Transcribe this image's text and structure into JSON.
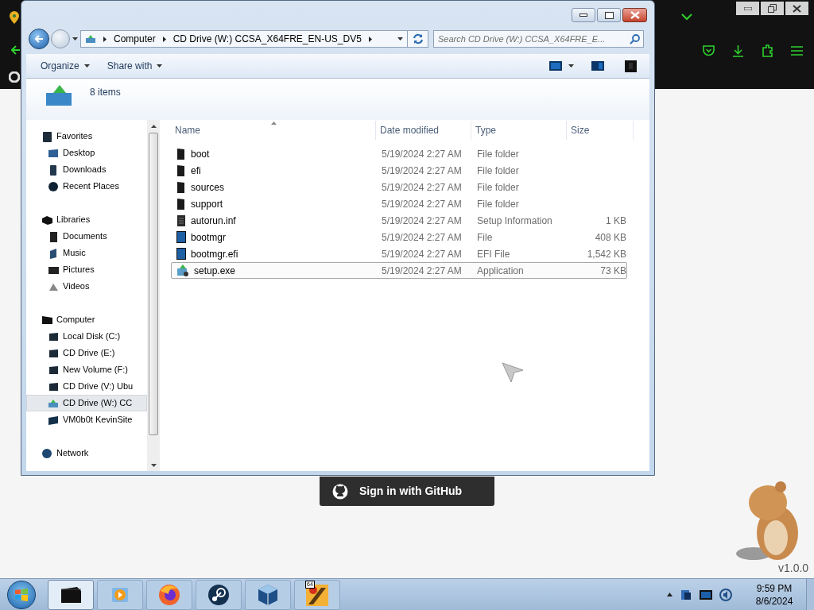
{
  "browser": {
    "signin_button": "Sign in with GitHub",
    "version_label": "v1.0.0"
  },
  "explorer": {
    "breadcrumb": [
      "Computer",
      "CD Drive (W:) CCSA_X64FRE_EN-US_DV5"
    ],
    "search": {
      "placeholder": "Search CD Drive (W:) CCSA_X64FRE_E..."
    },
    "toolbar": [
      "Organize",
      "Share with"
    ],
    "details": "8 items",
    "nav": [
      {
        "label": "Favorites",
        "kind": "star",
        "selected": false,
        "children": [
          {
            "label": "Desktop",
            "kind": "desktop",
            "selected": false
          },
          {
            "label": "Downloads",
            "kind": "download",
            "selected": false
          },
          {
            "label": "Recent Places",
            "kind": "recent",
            "selected": false
          }
        ]
      },
      {
        "label": "Libraries",
        "kind": "library",
        "selected": false,
        "children": [
          {
            "label": "Documents",
            "kind": "document",
            "selected": false
          },
          {
            "label": "Music",
            "kind": "music",
            "selected": false
          },
          {
            "label": "Pictures",
            "kind": "picture",
            "selected": false
          },
          {
            "label": "Videos",
            "kind": "video",
            "selected": false
          }
        ]
      },
      {
        "label": "Computer",
        "kind": "computer",
        "selected": false,
        "children": [
          {
            "label": "Local Disk (C:)",
            "kind": "drive",
            "selected": false
          },
          {
            "label": "CD Drive (E:)",
            "kind": "drive",
            "selected": false
          },
          {
            "label": "New Volume (F:)",
            "kind": "drive",
            "selected": false
          },
          {
            "label": "CD Drive (V:) Ubu",
            "kind": "drive",
            "selected": false
          },
          {
            "label": "CD Drive (W:) CC",
            "kind": "cd",
            "selected": true
          },
          {
            "label": "VM0b0t KevinSite",
            "kind": "netdrive",
            "selected": false
          }
        ]
      },
      {
        "label": "Network",
        "kind": "network",
        "selected": false
      }
    ],
    "columns": [
      "Name",
      "Date modified",
      "Type",
      "Size"
    ],
    "rows": [
      {
        "name": "boot",
        "date": "5/19/2024 2:27 AM",
        "type": "File folder",
        "kind": "folder",
        "selected": false
      },
      {
        "name": "efi",
        "date": "5/19/2024 2:27 AM",
        "type": "File folder",
        "kind": "folder",
        "selected": false
      },
      {
        "name": "sources",
        "date": "5/19/2024 2:27 AM",
        "type": "File folder",
        "kind": "folder",
        "selected": false
      },
      {
        "name": "support",
        "date": "5/19/2024 2:27 AM",
        "type": "File folder",
        "kind": "folder",
        "selected": false
      },
      {
        "name": "autorun.inf",
        "date": "5/19/2024 2:27 AM",
        "type": "Setup Information",
        "size": "1 KB",
        "kind": "inf",
        "selected": false
      },
      {
        "name": "bootmgr",
        "date": "5/19/2024 2:27 AM",
        "type": "File",
        "size": "408 KB",
        "kind": "file",
        "selected": false
      },
      {
        "name": "bootmgr.efi",
        "date": "5/19/2024 2:27 AM",
        "type": "EFI File",
        "size": "1,542 KB",
        "kind": "file",
        "selected": false
      },
      {
        "name": "setup.exe",
        "date": "5/19/2024 2:27 AM",
        "type": "Application",
        "size": "73 KB",
        "kind": "app",
        "selected": true
      }
    ]
  },
  "taskbar": {
    "apps": [
      {
        "kind": "explorer",
        "selected": true
      },
      {
        "kind": "media",
        "selected": false
      },
      {
        "kind": "firefox",
        "selected": false
      },
      {
        "kind": "steam",
        "selected": false
      },
      {
        "kind": "virtualbox",
        "selected": false
      },
      {
        "kind": "app64",
        "badge": "64",
        "selected": false
      }
    ],
    "clock": {
      "time": "9:59 PM",
      "date": "8/6/2024"
    }
  }
}
